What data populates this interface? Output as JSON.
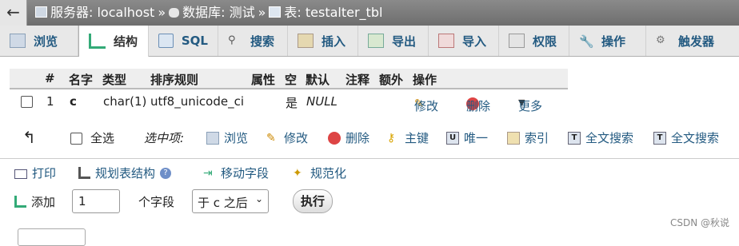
{
  "breadcrumb": {
    "server_label": "服务器: localhost",
    "database_label": "数据库: 测试",
    "table_label": "表: testalter_tbl",
    "separator": "»"
  },
  "tabs": [
    {
      "label": "浏览",
      "icon": "browse-icon"
    },
    {
      "label": "结构",
      "icon": "structure-icon",
      "active": true
    },
    {
      "label": "SQL",
      "icon": "sql-icon"
    },
    {
      "label": "搜索",
      "icon": "search-icon"
    },
    {
      "label": "插入",
      "icon": "insert-icon"
    },
    {
      "label": "导出",
      "icon": "export-icon"
    },
    {
      "label": "导入",
      "icon": "import-icon"
    },
    {
      "label": "权限",
      "icon": "privileges-icon"
    },
    {
      "label": "操作",
      "icon": "operations-icon"
    },
    {
      "label": "触发器",
      "icon": "triggers-icon"
    }
  ],
  "table": {
    "headers": {
      "num": "#",
      "name": "名字",
      "type": "类型",
      "collation": "排序规则",
      "attributes": "属性",
      "null": "空",
      "default": "默认",
      "comment": "注释",
      "extra": "额外",
      "action": "操作"
    },
    "rows": [
      {
        "num": "1",
        "name": "c",
        "type": "char(1)",
        "collation": "utf8_unicode_ci",
        "null": "是",
        "default": "NULL",
        "edit": "修改",
        "drop": "删除",
        "more": "更多"
      }
    ]
  },
  "selection": {
    "check_all": "全选",
    "with_selected": "选中项:",
    "actions": [
      "浏览",
      "修改",
      "删除",
      "主键",
      "唯一",
      "索引",
      "全文搜索",
      "全文搜索"
    ]
  },
  "tools": {
    "print": "打印",
    "propose": "规划表结构",
    "move": "移动字段",
    "normalize": "规范化"
  },
  "add": {
    "label": "添加",
    "count": "1",
    "unit": "个字段",
    "position_selected": "于 c 之后",
    "go": "执行"
  },
  "watermark": "CSDN @秋说",
  "colors": {
    "link": "#235a81",
    "topbar": "#7a7a7a",
    "tabbar": "#e8e8e8"
  }
}
